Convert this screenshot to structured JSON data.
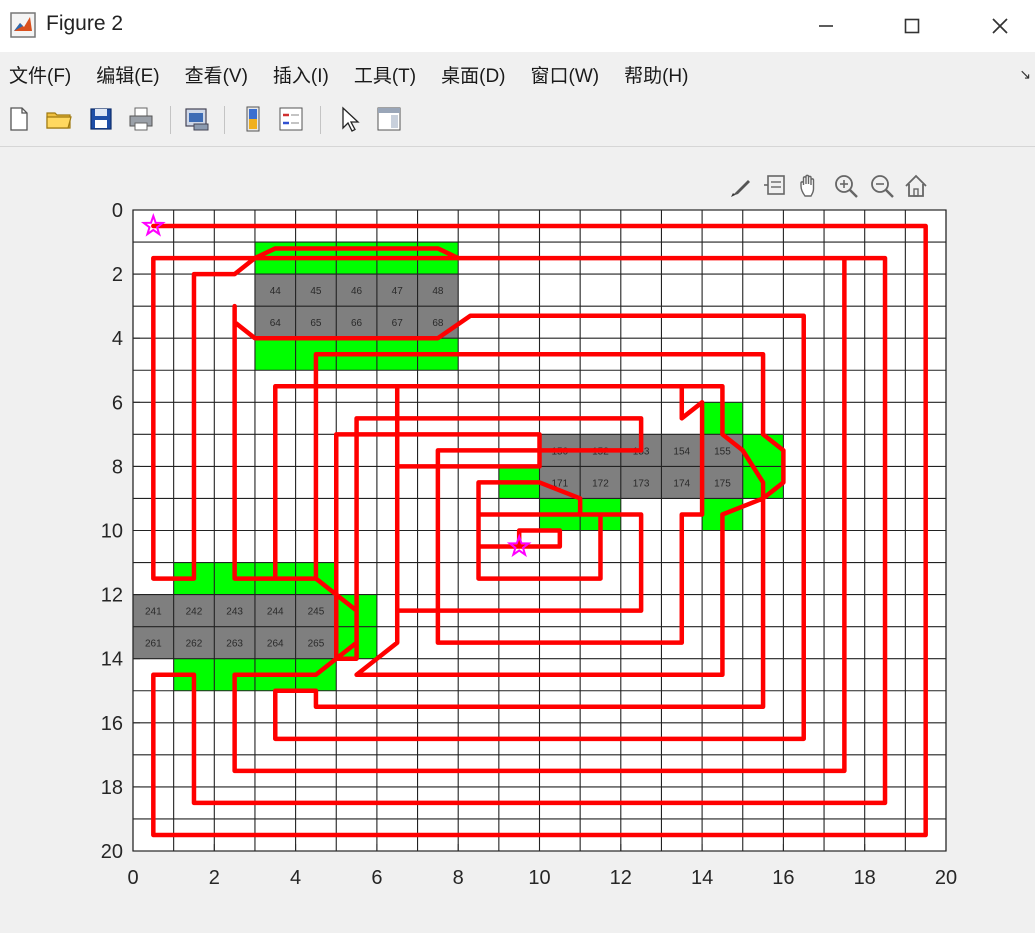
{
  "window": {
    "title": "Figure 2"
  },
  "menu": [
    "文件(F)",
    "编辑(E)",
    "查看(V)",
    "插入(I)",
    "工具(T)",
    "桌面(D)",
    "窗口(W)",
    "帮助(H)"
  ],
  "toolbar": [
    "new-file-icon",
    "open-folder-icon",
    "save-icon",
    "print-icon",
    "link-plot-icon",
    "colorbar-icon",
    "legend-icon",
    "pointer-icon",
    "property-inspector-icon"
  ],
  "axes_toolbar": [
    "brush-icon",
    "datatip-icon",
    "pan-icon",
    "zoom-in-icon",
    "zoom-out-icon",
    "home-icon"
  ],
  "chart_data": {
    "type": "grid-path",
    "xlim": [
      0,
      20
    ],
    "ylim": [
      20,
      0
    ],
    "y_reversed": true,
    "xticks": [
      0,
      2,
      4,
      6,
      8,
      10,
      12,
      14,
      16,
      18,
      20
    ],
    "yticks": [
      0,
      2,
      4,
      6,
      8,
      10,
      12,
      14,
      16,
      18,
      20
    ],
    "grid": true,
    "colors": {
      "path": "#ff0000",
      "obstacle": "#7f7f7f",
      "buffer": "#00ff00",
      "marker": "#ff00ff",
      "grid": "#222222"
    },
    "obstacles": [
      {
        "x": [
          3,
          8
        ],
        "y": [
          2,
          4
        ],
        "labels": [
          "44",
          "45",
          "46",
          "47",
          "48",
          "64",
          "65",
          "66",
          "67",
          "68"
        ]
      },
      {
        "x": [
          10,
          15
        ],
        "y": [
          7,
          9
        ],
        "labels": [
          "150",
          "152",
          "153",
          "154",
          "155",
          "171",
          "172",
          "173",
          "174",
          "175"
        ]
      },
      {
        "x": [
          0,
          5
        ],
        "y": [
          12,
          14
        ],
        "labels": [
          "241",
          "242",
          "243",
          "244",
          "245",
          "261",
          "262",
          "263",
          "264",
          "265"
        ]
      }
    ],
    "buffer_zones": [
      [
        [
          3,
          1
        ],
        [
          8,
          1
        ],
        [
          8,
          5
        ],
        [
          3,
          5
        ]
      ],
      [
        [
          14,
          6
        ],
        [
          15,
          6
        ],
        [
          15,
          7
        ],
        [
          16,
          7
        ],
        [
          16,
          9
        ],
        [
          15,
          9
        ],
        [
          15,
          10
        ],
        [
          14,
          10
        ],
        [
          14,
          9
        ],
        [
          12,
          9
        ],
        [
          12,
          10
        ],
        [
          10,
          10
        ],
        [
          10,
          9
        ],
        [
          9,
          9
        ],
        [
          9,
          8
        ],
        [
          10,
          8
        ],
        [
          10,
          7
        ],
        [
          14,
          7
        ]
      ],
      [
        [
          1,
          11
        ],
        [
          5,
          11
        ],
        [
          5,
          12
        ],
        [
          6,
          12
        ],
        [
          6,
          14
        ],
        [
          5,
          14
        ],
        [
          5,
          15
        ],
        [
          1,
          15
        ],
        [
          1,
          14
        ],
        [
          0,
          14
        ],
        [
          0,
          12
        ],
        [
          1,
          12
        ]
      ]
    ],
    "start": {
      "x": 0.5,
      "y": 0.5
    },
    "end": {
      "x": 9.5,
      "y": 10.5
    },
    "path": [
      [
        0.5,
        0.5
      ],
      [
        19.5,
        0.5
      ],
      [
        19.5,
        19.5
      ],
      [
        0.5,
        19.5
      ],
      [
        0.5,
        14.5
      ],
      [
        1.5,
        14.5
      ],
      [
        1.5,
        18.5
      ],
      [
        18.5,
        18.5
      ],
      [
        18.5,
        1.5
      ],
      [
        8,
        1.5
      ],
      [
        7.5,
        1.2
      ],
      [
        3.5,
        1.2
      ],
      [
        3,
        1.5
      ],
      [
        2.5,
        2
      ],
      [
        1.5,
        2
      ],
      [
        1.5,
        11.5
      ],
      [
        0.5,
        11.5
      ],
      [
        0.5,
        1.5
      ],
      [
        17.5,
        1.5
      ],
      [
        17.5,
        17.5
      ],
      [
        2.5,
        17.5
      ],
      [
        2.5,
        14.5
      ],
      [
        4.5,
        14.5
      ],
      [
        5.5,
        13.5
      ],
      [
        5.5,
        12.5
      ],
      [
        4.5,
        11.5
      ],
      [
        2.5,
        11.5
      ],
      [
        2.5,
        3
      ],
      [
        2.5,
        3.5
      ],
      [
        3.0,
        4.0
      ],
      [
        7.5,
        4.0
      ],
      [
        8.3,
        3.3
      ],
      [
        16.5,
        3.3
      ],
      [
        16.5,
        16.5
      ],
      [
        3.5,
        16.5
      ],
      [
        3.5,
        15.0
      ],
      [
        4.5,
        15.0
      ],
      [
        4.5,
        15.5
      ],
      [
        15.5,
        15.5
      ],
      [
        15.5,
        8.5
      ],
      [
        15.0,
        7.5
      ],
      [
        14.5,
        7.0
      ],
      [
        14.5,
        5.5
      ],
      [
        3.5,
        5.5
      ],
      [
        3.5,
        11.5
      ],
      [
        4.5,
        11.5
      ],
      [
        4.5,
        4.5
      ],
      [
        15.5,
        4.5
      ],
      [
        15.5,
        7.0
      ],
      [
        16.0,
        7.5
      ],
      [
        16.0,
        8.5
      ],
      [
        15.5,
        9.0
      ],
      [
        14.5,
        9.5
      ],
      [
        14.5,
        14.5
      ],
      [
        5.5,
        14.5
      ],
      [
        6.5,
        13.5
      ],
      [
        6.5,
        5.5
      ],
      [
        13.5,
        5.5
      ],
      [
        13.5,
        6.5
      ],
      [
        14.0,
        6.0
      ],
      [
        14.0,
        9.5
      ],
      [
        13.5,
        9.5
      ],
      [
        13.5,
        13.5
      ],
      [
        7.5,
        13.5
      ],
      [
        7.5,
        7.5
      ],
      [
        12.5,
        7.5
      ],
      [
        12.5,
        6.5
      ],
      [
        5.5,
        6.5
      ],
      [
        5.5,
        14.0
      ],
      [
        5.0,
        14.0
      ],
      [
        5.0,
        7.0
      ],
      [
        10.0,
        7.0
      ],
      [
        10.0,
        8.0
      ],
      [
        6.5,
        8.0
      ],
      [
        6.5,
        12.5
      ],
      [
        12.5,
        12.5
      ],
      [
        12.5,
        9.5
      ],
      [
        11.0,
        9.5
      ],
      [
        11.0,
        9.0
      ],
      [
        10.0,
        8.5
      ],
      [
        8.5,
        8.5
      ],
      [
        8.5,
        11.5
      ],
      [
        11.5,
        11.5
      ],
      [
        11.5,
        9.5
      ],
      [
        8.5,
        9.5
      ],
      [
        8.5,
        10.5
      ],
      [
        10.5,
        10.5
      ],
      [
        10.5,
        10.0
      ],
      [
        9.5,
        10.0
      ],
      [
        9.5,
        10.5
      ]
    ]
  }
}
